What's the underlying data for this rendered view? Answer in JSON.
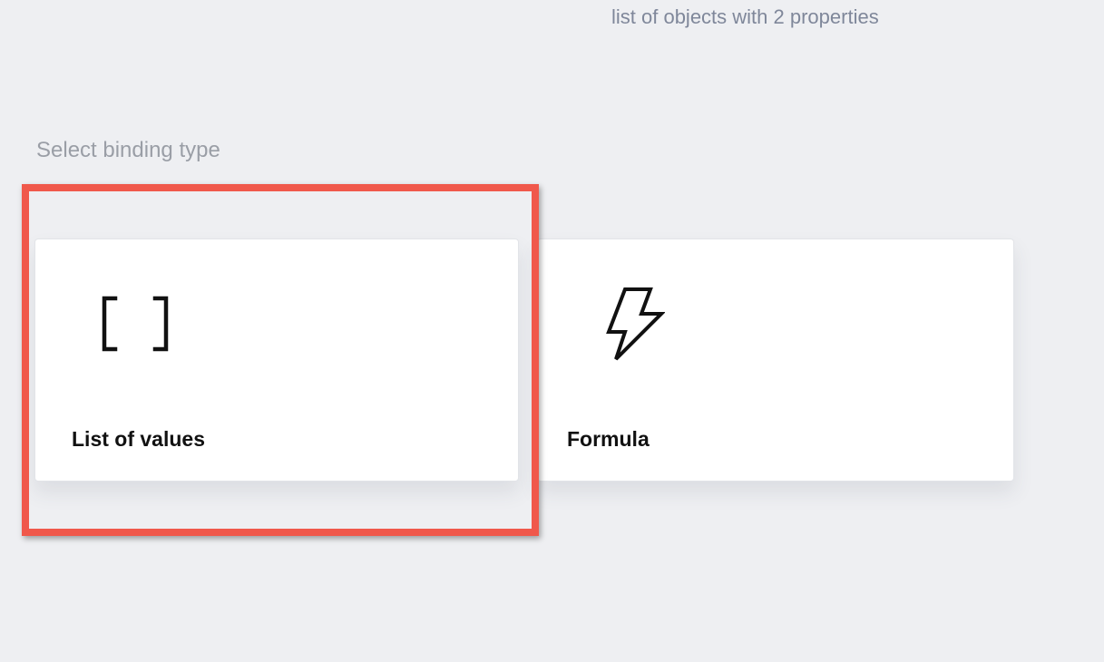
{
  "header": {
    "hint": "list of objects with 2 properties"
  },
  "binding": {
    "section_label": "Select binding type",
    "options": [
      {
        "label": "List of values",
        "icon": "brackets-icon"
      },
      {
        "label": "Formula",
        "icon": "lightning-icon"
      }
    ],
    "highlighted_option": "List of values"
  },
  "colors": {
    "background": "#eeeff2",
    "highlight": "#f0584b",
    "card": "#ffffff"
  }
}
